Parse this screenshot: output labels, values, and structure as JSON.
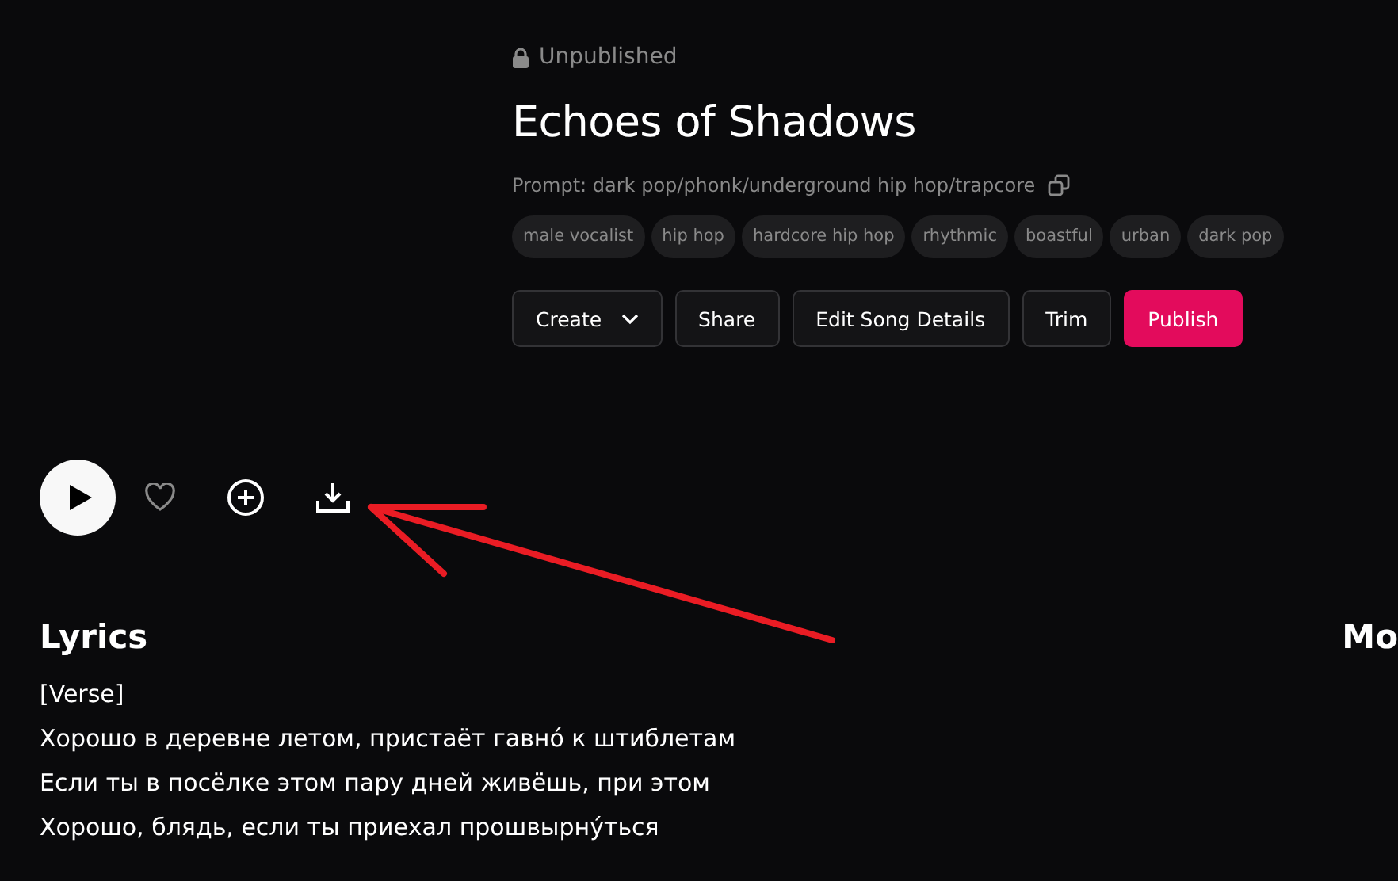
{
  "song": {
    "status": "Unpublished",
    "title": "Echoes of Shadows",
    "prompt": "Prompt: dark pop/phonk/underground hip hop/trapcore",
    "tags": [
      "male vocalist",
      "hip hop",
      "hardcore hip hop",
      "rhythmic",
      "boastful",
      "urban",
      "dark pop"
    ],
    "actions": [
      {
        "label": "Create",
        "kind": "dropdown"
      },
      {
        "label": "Share",
        "kind": "plain"
      },
      {
        "label": "Edit Song Details",
        "kind": "plain"
      },
      {
        "label": "Trim",
        "kind": "plain"
      },
      {
        "label": "Publish",
        "kind": "primary"
      }
    ]
  },
  "player": {
    "liked": false
  },
  "lyrics": {
    "heading": "Lyrics",
    "lines": [
      "[Verse]",
      "Хорошо в деревне летом, пристаёт гавно́ к штиблетам",
      "Если ты в посёлке этом пару дней живёшь, при этом",
      "Хорошо, блядь, если ты приехал прошвырну́ться"
    ]
  },
  "side_heading": "Mo"
}
